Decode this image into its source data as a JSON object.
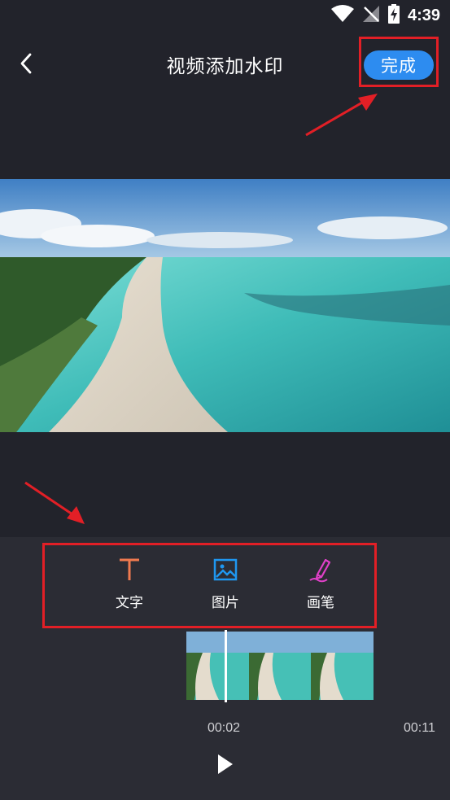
{
  "status_bar": {
    "time": "4:39",
    "icons": [
      "wifi-icon",
      "no-signal-icon",
      "battery-charging-icon"
    ]
  },
  "header": {
    "back_icon": "back-arrow-icon",
    "title": "视频添加水印",
    "done_label": "完成"
  },
  "tools": [
    {
      "label": "文字",
      "icon": "text-icon",
      "color": "#f07a4f"
    },
    {
      "label": "图片",
      "icon": "image-icon",
      "color": "#1f97f0"
    },
    {
      "label": "画笔",
      "icon": "brush-icon",
      "color": "#e040c8"
    }
  ],
  "timeline": {
    "current_time": "00:02",
    "total_time": "00:11",
    "play_icon": "play-icon",
    "frame_count": 3
  },
  "colors": {
    "background": "#22232b",
    "panel": "#2b2c34",
    "accent": "#2d8cf0",
    "highlight_border": "#e21f26"
  }
}
